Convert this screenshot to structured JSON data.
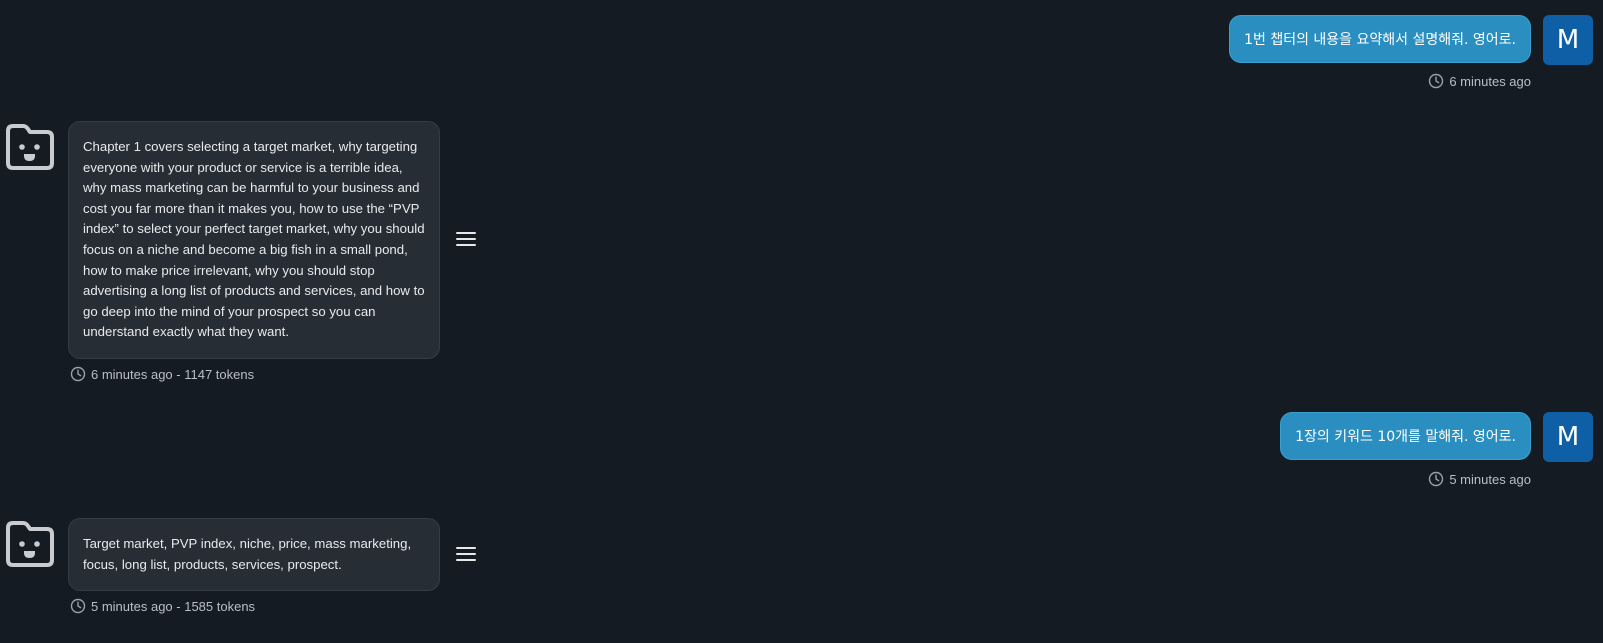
{
  "messages": [
    {
      "role": "user",
      "avatar_letter": "M",
      "text": "1번 챕터의 내용을 요약해서 설명해줘. 영어로.",
      "meta": "6 minutes ago"
    },
    {
      "role": "assistant",
      "text": "Chapter 1 covers selecting a target market, why targeting everyone with your product or service is a terrible idea, why mass marketing can be harmful to your business and cost you far more than it makes you, how to use the “PVP index” to select your perfect target market, why you should focus on a niche and become a big fish in a small pond, how to make price irrelevant, why you should stop advertising a long list of products and services, and how to go deep into the mind of your prospect so you can understand exactly what they want.",
      "meta": "6 minutes ago - 1147 tokens"
    },
    {
      "role": "user",
      "avatar_letter": "M",
      "text": "1장의 키워드 10개를 말해줘. 영어로.",
      "meta": "5 minutes ago"
    },
    {
      "role": "assistant",
      "text": "Target market, PVP index, niche, price, mass marketing, focus, long list, products, services, prospect.",
      "meta": "5 minutes ago - 1585 tokens"
    }
  ],
  "icons": {
    "user_avatar": "letter-avatar",
    "bot_avatar": "smiling-face-folder-icon",
    "menu": "hamburger-menu-icon",
    "timestamp": "clock-icon"
  },
  "colors": {
    "background": "#151b22",
    "user_bubble": "#2a8fc0",
    "user_avatar": "#0e5fa5",
    "bot_bubble": "#262d35",
    "meta_text": "#b9bfc6"
  }
}
